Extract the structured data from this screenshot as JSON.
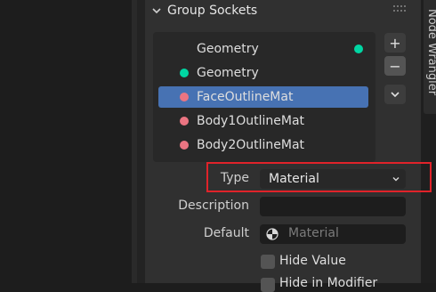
{
  "panel": {
    "title": "Group Sockets",
    "side_tab_label": "Node Wrangler"
  },
  "sockets": [
    {
      "label": "Geometry",
      "kind": "output",
      "color": "#00d6a3",
      "selected": false
    },
    {
      "label": "Geometry",
      "kind": "input",
      "color": "#00d6a3",
      "selected": false
    },
    {
      "label": "FaceOutlineMat",
      "kind": "input",
      "color": "#eb7582",
      "selected": true
    },
    {
      "label": "Body1OutlineMat",
      "kind": "input",
      "color": "#eb7582",
      "selected": false
    },
    {
      "label": "Body2OutlineMat",
      "kind": "input",
      "color": "#eb7582",
      "selected": false
    }
  ],
  "buttons": {
    "add": "+",
    "remove": "−"
  },
  "properties": {
    "type_label": "Type",
    "type_value": "Material",
    "description_label": "Description",
    "description_value": "",
    "default_label": "Default",
    "default_placeholder": "Material"
  },
  "checkboxes": {
    "hide_value": "Hide Value",
    "hide_in_modifier": "Hide in Modifier"
  }
}
